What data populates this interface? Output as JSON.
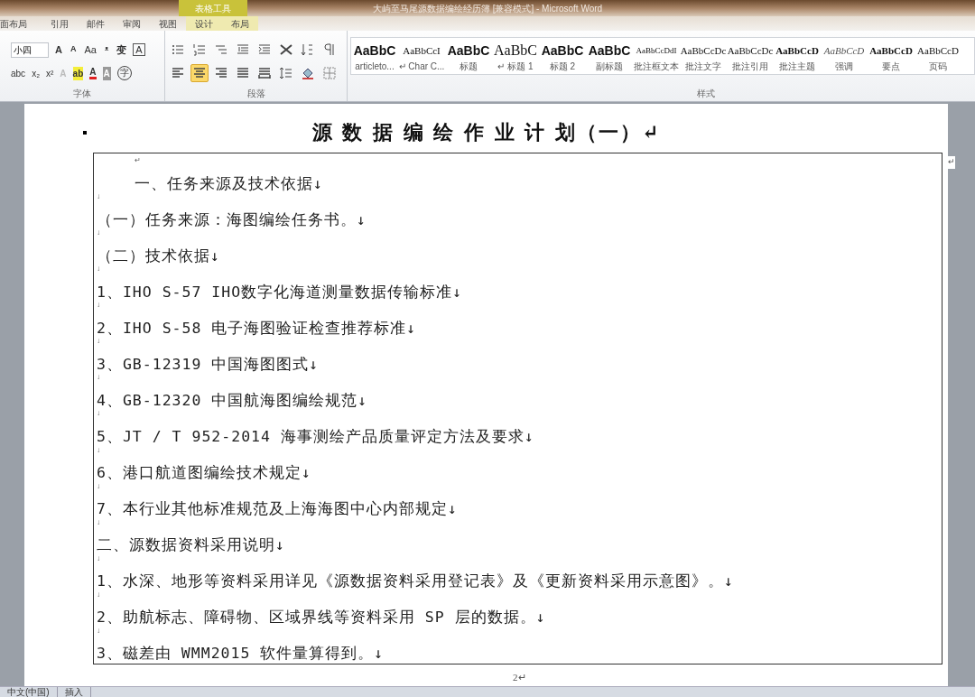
{
  "window": {
    "title": "大屿至马尾源数据编绘经历簿 [兼容模式] - Microsoft Word",
    "context_group": "表格工具"
  },
  "tabs": [
    {
      "label": "面布局",
      "selected": false,
      "contextual": false
    },
    {
      "label": "引用",
      "selected": false,
      "contextual": false
    },
    {
      "label": "邮件",
      "selected": false,
      "contextual": false
    },
    {
      "label": "审阅",
      "selected": false,
      "contextual": false
    },
    {
      "label": "视图",
      "selected": false,
      "contextual": false
    },
    {
      "label": "设计",
      "selected": false,
      "contextual": true
    },
    {
      "label": "布局",
      "selected": false,
      "contextual": true
    }
  ],
  "font_group": {
    "label": "字体",
    "size_field": "小四",
    "row1": [
      {
        "kind": "grow",
        "text": "A"
      },
      {
        "kind": "shrink",
        "text": "A"
      },
      {
        "kind": "case",
        "text": "Aa"
      },
      {
        "kind": "clear",
        "text": "ᵜ"
      },
      {
        "kind": "phonetic",
        "text": "变"
      },
      {
        "kind": "boxed",
        "text": "A"
      }
    ],
    "row2": [
      {
        "kind": "plain",
        "text": "abc"
      },
      {
        "kind": "plain",
        "text": "x₂"
      },
      {
        "kind": "plain",
        "text": "x²"
      },
      {
        "kind": "effect",
        "text": "A"
      },
      {
        "kind": "highlight",
        "text": "ab"
      },
      {
        "kind": "color",
        "text": "A"
      },
      {
        "kind": "shade",
        "text": "A"
      },
      {
        "kind": "enclose",
        "text": "字"
      }
    ]
  },
  "paragraph_group": {
    "label": "段落",
    "row1": [
      {
        "kind": "bullets",
        "selected": false
      },
      {
        "kind": "numbering",
        "selected": false
      },
      {
        "kind": "multilevel",
        "selected": false
      },
      {
        "kind": "outdent",
        "selected": false
      },
      {
        "kind": "indent",
        "selected": false
      },
      {
        "kind": "asian",
        "selected": false
      },
      {
        "kind": "sort",
        "selected": false
      },
      {
        "kind": "marks",
        "selected": false
      }
    ],
    "row2": [
      {
        "kind": "left",
        "selected": false
      },
      {
        "kind": "center",
        "selected": true
      },
      {
        "kind": "right",
        "selected": false
      },
      {
        "kind": "justify",
        "selected": false
      },
      {
        "kind": "distribute",
        "selected": false
      },
      {
        "kind": "spacing",
        "selected": false
      },
      {
        "kind": "fill",
        "selected": false
      },
      {
        "kind": "border",
        "selected": false
      }
    ]
  },
  "styles": {
    "label": "样式",
    "items": [
      {
        "sample": "AaBbC",
        "name": "articleto...",
        "kind": "bold"
      },
      {
        "sample": "AaBbCcI",
        "name": "↵ Char C...",
        "kind": "plain"
      },
      {
        "sample": "AaBbC",
        "name": "标题",
        "kind": "bold"
      },
      {
        "sample": "AaBbC",
        "name": "↵ 标题 1",
        "kind": "large"
      },
      {
        "sample": "AaBbC",
        "name": "标题 2",
        "kind": "bold"
      },
      {
        "sample": "AaBbC",
        "name": "副标题",
        "kind": "bold"
      },
      {
        "sample": "AaBbCcDdI",
        "name": "批注框文本",
        "kind": "small"
      },
      {
        "sample": "AaBbCcDc",
        "name": "批注文字",
        "kind": "plain"
      },
      {
        "sample": "AaBbCcDc",
        "name": "批注引用",
        "kind": "plain"
      },
      {
        "sample": "AaBbCcD",
        "name": "批注主题",
        "kind": "bold"
      },
      {
        "sample": "AaBbCcD",
        "name": "强调",
        "kind": "italic"
      },
      {
        "sample": "AaBbCcD",
        "name": "要点",
        "kind": "bold"
      },
      {
        "sample": "AaBbCcD",
        "name": "页码",
        "kind": "plain"
      }
    ]
  },
  "document": {
    "title": "源 数 据 编 绘 作 业 计 划（一）↵",
    "row_end_mark": "↵",
    "page_number": "2↵",
    "lines": [
      {
        "text": "↵",
        "kind": "indented_mark"
      },
      {
        "text": "一、任务来源及技术依据↓",
        "kind": "indented_text"
      },
      {
        "text": "↓",
        "kind": "mark"
      },
      {
        "text": "（一）任务来源：海图编绘任务书。↓",
        "kind": "text"
      },
      {
        "text": "↓",
        "kind": "mark"
      },
      {
        "text": "（二）技术依据↓",
        "kind": "text"
      },
      {
        "text": "↓",
        "kind": "mark"
      },
      {
        "text": "1、IHO S-57 IHO数字化海道测量数据传输标准↓",
        "kind": "text"
      },
      {
        "text": "↓",
        "kind": "mark"
      },
      {
        "text": "2、IHO S-58 电子海图验证检查推荐标准↓",
        "kind": "text"
      },
      {
        "text": "↓",
        "kind": "mark"
      },
      {
        "text": "3、GB-12319 中国海图图式↓",
        "kind": "text"
      },
      {
        "text": "↓",
        "kind": "mark"
      },
      {
        "text": "4、GB-12320 中国航海图编绘规范↓",
        "kind": "text"
      },
      {
        "text": "↓",
        "kind": "mark"
      },
      {
        "text": "5、JT / T 952-2014 海事测绘产品质量评定方法及要求↓",
        "kind": "text"
      },
      {
        "text": "↓",
        "kind": "mark"
      },
      {
        "text": "6、港口航道图编绘技术规定↓",
        "kind": "text"
      },
      {
        "text": "↓",
        "kind": "mark"
      },
      {
        "text": "7、本行业其他标准规范及上海海图中心内部规定↓",
        "kind": "text"
      },
      {
        "text": "↓",
        "kind": "mark"
      },
      {
        "text": "二、源数据资料采用说明↓",
        "kind": "text"
      },
      {
        "text": "↓",
        "kind": "mark"
      },
      {
        "text": "1、水深、地形等资料采用详见《源数据资料采用登记表》及《更新资料采用示意图》。↓",
        "kind": "text"
      },
      {
        "text": "↓",
        "kind": "mark"
      },
      {
        "text": "2、助航标志、障碍物、区域界线等资料采用 SP 层的数据。↓",
        "kind": "text"
      },
      {
        "text": "↓",
        "kind": "mark"
      },
      {
        "text": "3、磁差由 WMM2015 软件量算得到。↓",
        "kind": "text"
      }
    ]
  },
  "status_bar": {
    "items": [
      "中文(中国)",
      "插入"
    ]
  }
}
